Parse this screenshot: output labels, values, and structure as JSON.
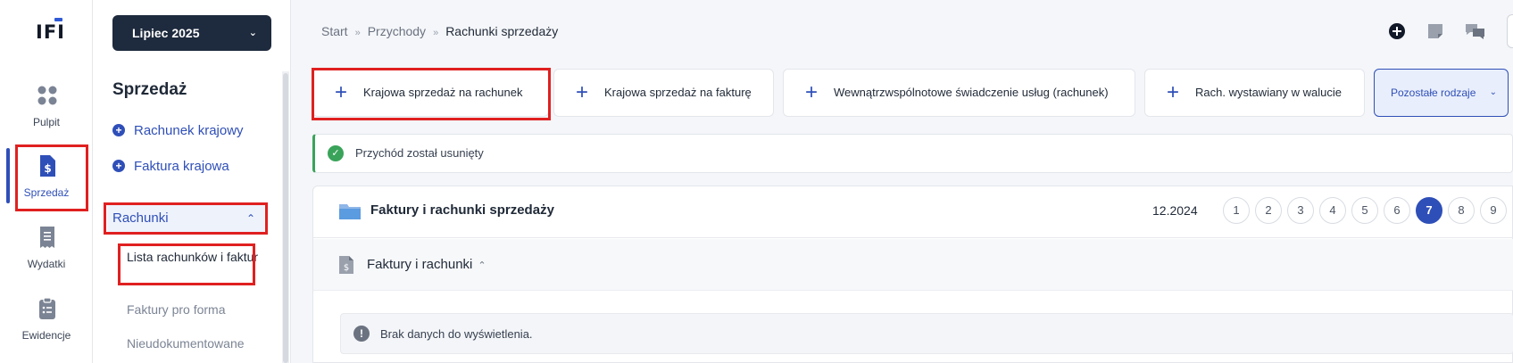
{
  "logo": {
    "text": "IFI"
  },
  "rail": {
    "items": [
      {
        "label": "Pulpit",
        "icon": "dashboard-icon"
      },
      {
        "label": "Sprzedaż",
        "icon": "sales-document-icon"
      },
      {
        "label": "Wydatki",
        "icon": "receipt-icon"
      },
      {
        "label": "Ewidencje",
        "icon": "clipboard-icon"
      }
    ]
  },
  "sidebar": {
    "month": "Lipiec 2025",
    "title": "Sprzedaż",
    "quick_links": [
      "Rachunek krajowy",
      "Faktura krajowa"
    ],
    "group_label": "Rachunki",
    "sub_items": [
      "Lista rachunków i faktur",
      "Faktury pro forma",
      "Nieudokumentowane"
    ]
  },
  "breadcrumb": {
    "items": [
      "Start",
      "Przychody",
      "Rachunki sprzedaży"
    ],
    "separator": "»"
  },
  "actions": {
    "buttons": [
      "Krajowa sprzedaż na rachunek",
      "Krajowa sprzedaż na fakturę",
      "Wewnątrzwspólnotowe świadczenie usług (rachunek)",
      "Rach. wystawiany w walucie"
    ],
    "more": "Pozostałe rodzaje"
  },
  "alert": {
    "message": "Przychód został usunięty"
  },
  "panel": {
    "title": "Faktury i rachunki sprzedaży",
    "period": "12.2024",
    "pages": [
      "1",
      "2",
      "3",
      "4",
      "5",
      "6",
      "7",
      "8",
      "9"
    ],
    "active_page": "7",
    "section_title": "Faktury i rachunki",
    "empty_message": "Brak danych do wyświetlenia."
  },
  "colors": {
    "accent": "#2f4fb8",
    "success": "#3aa35a",
    "highlight": "#e02020",
    "dark": "#1e2a3d"
  }
}
